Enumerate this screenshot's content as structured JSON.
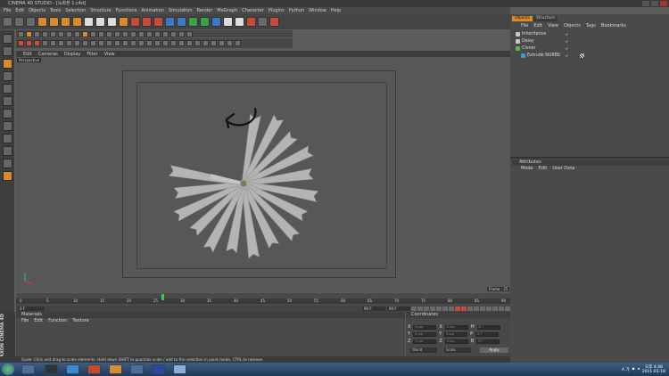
{
  "window": {
    "title": "CINEMA 4D STUDIO - [녹화본 1.c4d]"
  },
  "menubar": {
    "items": [
      "File",
      "Edit",
      "Objects",
      "Tools",
      "Selection",
      "Structure",
      "Functions",
      "Animation",
      "Simulation",
      "Render",
      "MoGraph",
      "Character",
      "Plugins",
      "Python",
      "Window",
      "Help"
    ]
  },
  "viewport": {
    "label": "Perspective",
    "menu": [
      "Edit",
      "Cameras",
      "Display",
      "Filter",
      "View"
    ],
    "frame_label": "Frame : 25"
  },
  "timeline": {
    "ticks": [
      "0",
      "5",
      "10",
      "15",
      "20",
      "25",
      "30",
      "35",
      "40",
      "45",
      "50",
      "55",
      "60",
      "65",
      "70",
      "75",
      "80",
      "85",
      "90"
    ],
    "current_frame": "25",
    "start_field": "0 F",
    "end_field": "90 F",
    "max_field": "90 F"
  },
  "materials": {
    "title": "Materials",
    "menu": [
      "File",
      "Edit",
      "Function",
      "Texture"
    ]
  },
  "coordinates": {
    "title": "Coordinates",
    "rows": [
      {
        "a": "X",
        "a_val": "0 cm",
        "b": "X",
        "b_val": "0 cm",
        "c": "H",
        "c_val": "0 °"
      },
      {
        "a": "Y",
        "a_val": "0 cm",
        "b": "Y",
        "b_val": "0 cm",
        "c": "P",
        "c_val": "0 °"
      },
      {
        "a": "Z",
        "a_val": "0 cm",
        "b": "Z",
        "b_val": "0 cm",
        "c": "B",
        "c_val": "0 °"
      }
    ],
    "mode1": "World",
    "mode2": "Scale",
    "apply": "Apply"
  },
  "status": {
    "text": "Scale: Click and drag to scale elements. Hold down SHIFT to quantize scale / add to the selection in point mode, CTRL to remove."
  },
  "logo": {
    "text": "MAXON CINEMA 4D"
  },
  "right": {
    "tabs": [
      "Objects",
      "Structure"
    ],
    "obj_menu": [
      "File",
      "Edit",
      "View",
      "Objects",
      "Tags",
      "Bookmarks"
    ],
    "objects": [
      {
        "name": "Inheritance",
        "color": "#c8c8c8"
      },
      {
        "name": "Delay",
        "color": "#c8c8c8"
      },
      {
        "name": "Cloner",
        "color": "#6ab04a"
      },
      {
        "name": "Extrude NURBS",
        "color": "#3a9ad8"
      }
    ],
    "attr_title": "Attributes",
    "attr_menu": [
      "Mode",
      "Edit",
      "User Data"
    ]
  },
  "taskbar": {
    "clock_time": "오후 4:48",
    "clock_date": "2011-03-18",
    "lang": "A 가"
  }
}
